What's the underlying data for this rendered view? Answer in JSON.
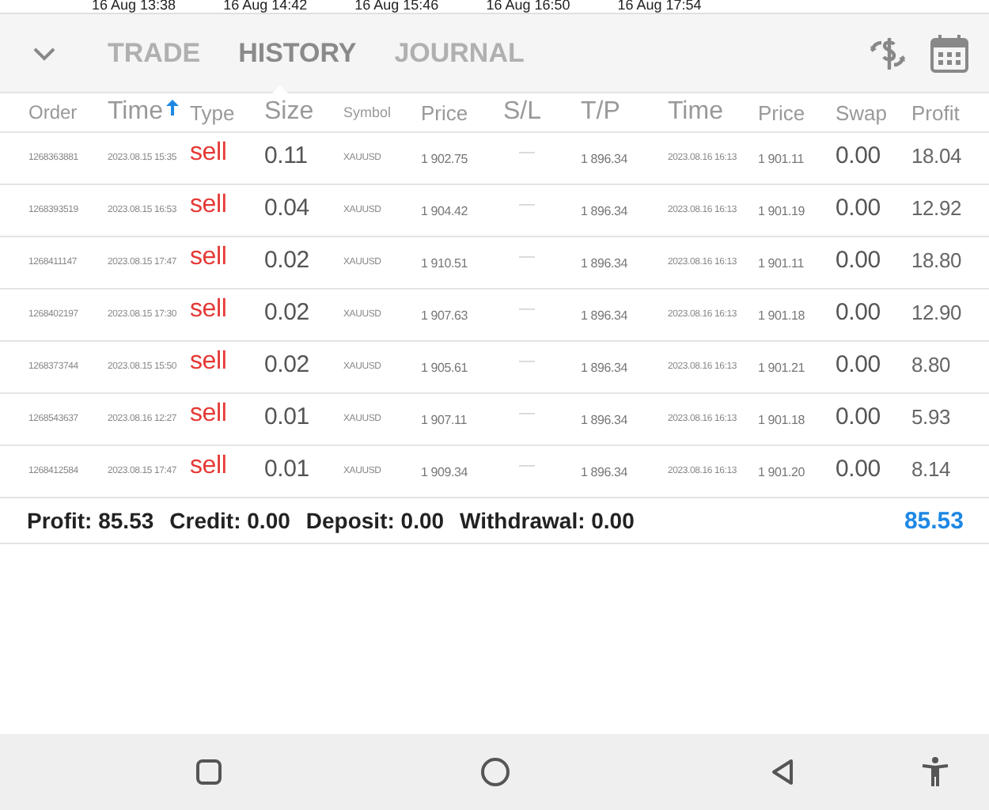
{
  "chart_axis_labels": [
    "16 Aug 13:38",
    "16 Aug 14:42",
    "16 Aug 15:46",
    "16 Aug 16:50",
    "16 Aug 17:54"
  ],
  "tabs": [
    {
      "label": "TRADE",
      "selected": false
    },
    {
      "label": "HISTORY",
      "selected": true
    },
    {
      "label": "JOURNAL",
      "selected": false
    }
  ],
  "table": {
    "columns": [
      "Order",
      "Time",
      "Type",
      "Size",
      "Symbol",
      "Price",
      "S/L",
      "T/P",
      "Time",
      "Price",
      "Swap",
      "Profit"
    ],
    "rows": [
      {
        "order": "1268363881",
        "open_time": "2023.08.15 15:35",
        "type": "sell",
        "size": "0.11",
        "symbol": "XAUUSD",
        "open_price": "1 902.75",
        "sl": "—",
        "tp": "1 896.34",
        "close_time": "2023.08.16 16:13",
        "close_price": "1 901.11",
        "swap": "0.00",
        "profit": "18.04"
      },
      {
        "order": "1268393519",
        "open_time": "2023.08.15 16:53",
        "type": "sell",
        "size": "0.04",
        "symbol": "XAUUSD",
        "open_price": "1 904.42",
        "sl": "—",
        "tp": "1 896.34",
        "close_time": "2023.08.16 16:13",
        "close_price": "1 901.19",
        "swap": "0.00",
        "profit": "12.92"
      },
      {
        "order": "1268411147",
        "open_time": "2023.08.15 17:47",
        "type": "sell",
        "size": "0.02",
        "symbol": "XAUUSD",
        "open_price": "1 910.51",
        "sl": "—",
        "tp": "1 896.34",
        "close_time": "2023.08.16 16:13",
        "close_price": "1 901.11",
        "swap": "0.00",
        "profit": "18.80"
      },
      {
        "order": "1268402197",
        "open_time": "2023.08.15 17:30",
        "type": "sell",
        "size": "0.02",
        "symbol": "XAUUSD",
        "open_price": "1 907.63",
        "sl": "—",
        "tp": "1 896.34",
        "close_time": "2023.08.16 16:13",
        "close_price": "1 901.18",
        "swap": "0.00",
        "profit": "12.90"
      },
      {
        "order": "1268373744",
        "open_time": "2023.08.15 15:50",
        "type": "sell",
        "size": "0.02",
        "symbol": "XAUUSD",
        "open_price": "1 905.61",
        "sl": "—",
        "tp": "1 896.34",
        "close_time": "2023.08.16 16:13",
        "close_price": "1 901.21",
        "swap": "0.00",
        "profit": "8.80"
      },
      {
        "order": "1268543637",
        "open_time": "2023.08.16 12:27",
        "type": "sell",
        "size": "0.01",
        "symbol": "XAUUSD",
        "open_price": "1 907.11",
        "sl": "—",
        "tp": "1 896.34",
        "close_time": "2023.08.16 16:13",
        "close_price": "1 901.18",
        "swap": "0.00",
        "profit": "5.93"
      },
      {
        "order": "1268412584",
        "open_time": "2023.08.15 17:47",
        "type": "sell",
        "size": "0.01",
        "symbol": "XAUUSD",
        "open_price": "1 909.34",
        "sl": "—",
        "tp": "1 896.34",
        "close_time": "2023.08.16 16:13",
        "close_price": "1 901.20",
        "swap": "0.00",
        "profit": "8.14"
      }
    ]
  },
  "summary": {
    "items": [
      {
        "label": "Profit:",
        "value": "85.53"
      },
      {
        "label": "Credit:",
        "value": "0.00"
      },
      {
        "label": "Deposit:",
        "value": "0.00"
      },
      {
        "label": "Withdrawal:",
        "value": "0.00"
      }
    ],
    "total": "85.53"
  }
}
